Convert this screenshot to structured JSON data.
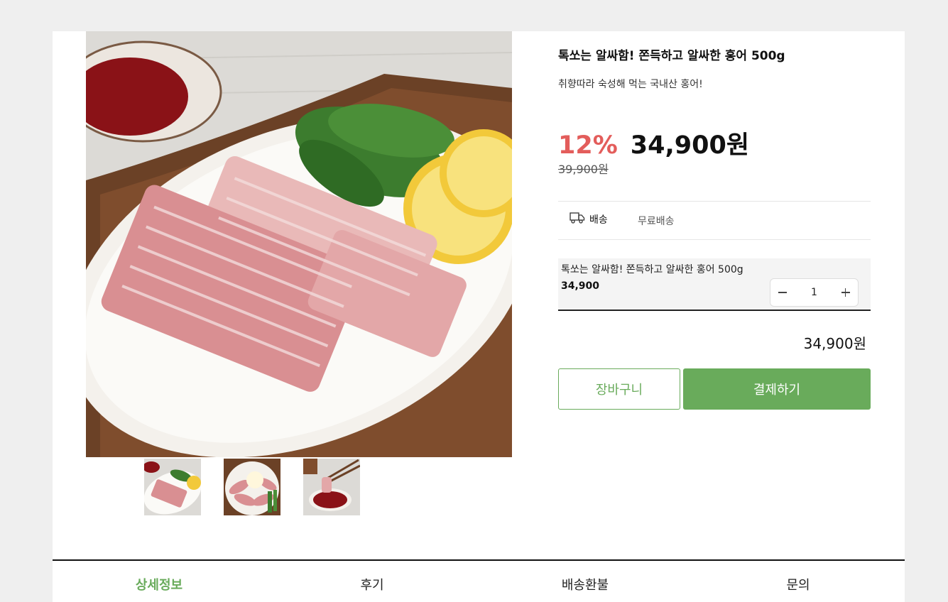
{
  "product": {
    "title": "톡쏘는 알싸함! 쫀득하고 알싸한 홍어 500g",
    "subtitle": "취향따라 숙성해 먹는 국내산 홍어!",
    "discount": "12%",
    "price": "34,900원",
    "original_price": "39,900원",
    "shipping_label": "배송",
    "shipping_value": "무료배송"
  },
  "option": {
    "name": "톡쏘는 알싸함! 쫀득하고 알싸한 홍어 500g",
    "price": "34,900",
    "quantity": "1"
  },
  "total": "34,900원",
  "buttons": {
    "cart": "장바구니",
    "buy": "결제하기"
  },
  "tabs": [
    {
      "label": "상세정보",
      "active": true
    },
    {
      "label": "후기"
    },
    {
      "label": "배송환불"
    },
    {
      "label": "문의"
    }
  ],
  "colors": {
    "accent": "#69ab5b",
    "discount": "#e35d5b",
    "background": "#efefef"
  }
}
